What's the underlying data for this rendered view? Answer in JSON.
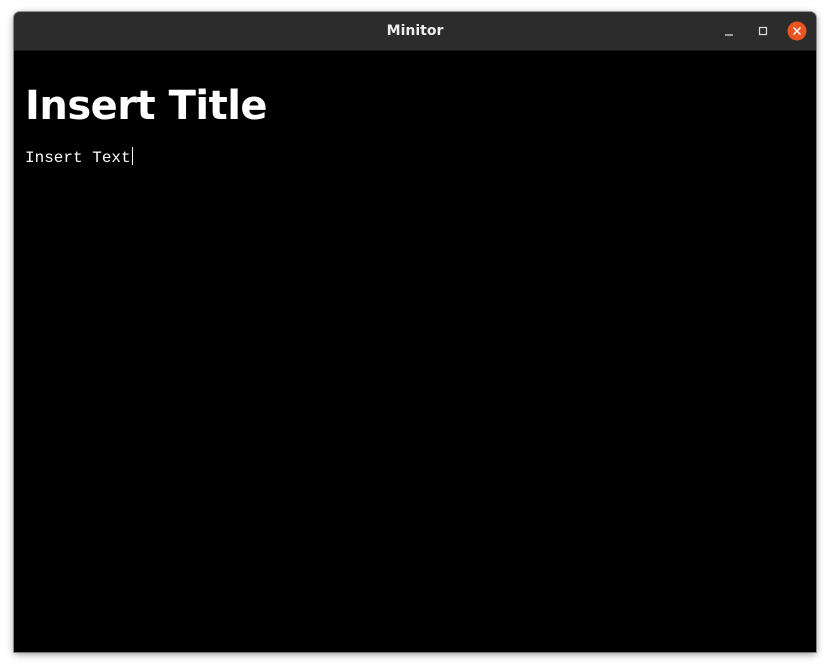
{
  "window": {
    "title": "Minitor"
  },
  "controls": {
    "minimize_icon": "minimize-icon",
    "maximize_icon": "maximize-icon",
    "close_icon": "close-icon",
    "close_color": "#e95420"
  },
  "editor": {
    "title": "Insert Title",
    "text": "Insert Text"
  },
  "colors": {
    "titlebar": "#2c2c2c",
    "background": "#000000",
    "foreground": "#ffffff"
  }
}
